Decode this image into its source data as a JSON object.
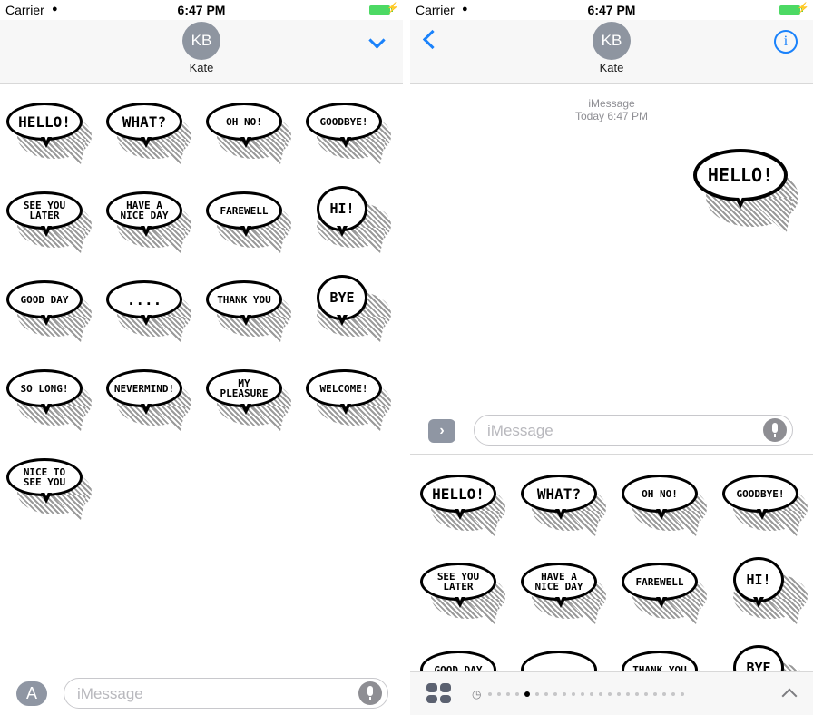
{
  "status_bar": {
    "carrier": "Carrier",
    "time": "6:47 PM"
  },
  "contact": {
    "initials": "KB",
    "name": "Kate"
  },
  "stickers": [
    "HELLO!",
    "WHAT?",
    "OH NO!",
    "GOODBYE!",
    "SEE YOU\nLATER",
    "HAVE A\nNICE DAY",
    "FAREWELL",
    "HI!",
    "GOOD DAY",
    "....",
    "THANK YOU",
    "BYE",
    "SO LONG!",
    "NEVERMIND!",
    "MY\nPLEASURE",
    "WELCOME!",
    "NICE TO\nSEE YOU"
  ],
  "left_screen": {
    "message_placeholder": "iMessage"
  },
  "right_screen": {
    "timestamp_service": "iMessage",
    "timestamp_time": "Today 6:47 PM",
    "sent_sticker": "HELLO!",
    "message_placeholder": "iMessage",
    "info_label": "i"
  },
  "tray": {
    "page_count": 22,
    "active_page": 4
  }
}
